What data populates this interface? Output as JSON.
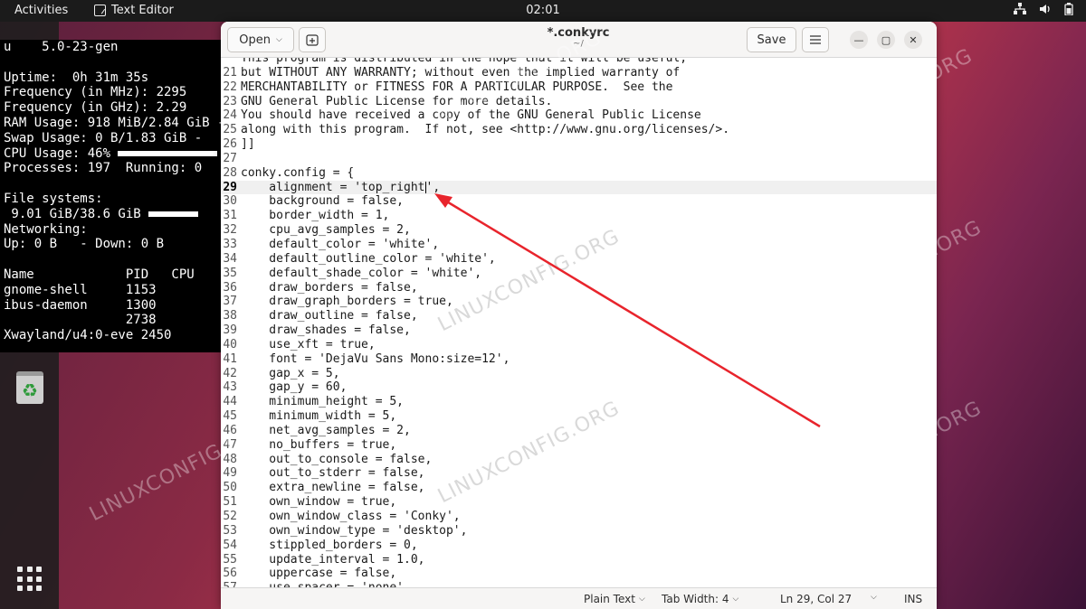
{
  "topbar": {
    "activities": "Activities",
    "app_name": "Text Editor",
    "clock": "02:01"
  },
  "conky": {
    "lines": [
      "u    5.0-23-gen",
      "",
      "Uptime:  0h 31m 35s",
      "Frequency (in MHz): 2295",
      "Frequency (in GHz): 2.29",
      "RAM Usage: 918 MiB/2.84 GiB - ",
      "Swap Usage: 0 B/1.83 GiB - ",
      "CPU Usage: 46% ",
      "Processes: 197  Running: 0",
      "",
      "File systems:",
      " 9.01 GiB/38.6 GiB ",
      "Networking:",
      "Up: 0 B   - Down: 0 B",
      "",
      "Name            PID   CPU",
      "gnome-shell     1153",
      "ibus-daemon     1300",
      "                2738",
      "Xwayland/u4:0-eve 2450"
    ],
    "cpu_fraction": 0.46,
    "fs_fraction": 0.23
  },
  "editor": {
    "open_label": "Open",
    "save_label": "Save",
    "title": "*.conkyrc",
    "subtitle": "~/",
    "current_line": 29,
    "lines": [
      {
        "n": "",
        "t": "This program is distributed in the hope that it will be useful,"
      },
      {
        "n": "21",
        "t": "but WITHOUT ANY WARRANTY; without even the implied warranty of"
      },
      {
        "n": "22",
        "t": "MERCHANTABILITY or FITNESS FOR A PARTICULAR PURPOSE.  See the"
      },
      {
        "n": "23",
        "t": "GNU General Public License for more details."
      },
      {
        "n": "24",
        "t": "You should have received a copy of the GNU General Public License"
      },
      {
        "n": "25",
        "t": "along with this program.  If not, see <http://www.gnu.org/licenses/>."
      },
      {
        "n": "26",
        "t": "]]"
      },
      {
        "n": "27",
        "t": ""
      },
      {
        "n": "28",
        "t": "conky.config = {"
      },
      {
        "n": "29",
        "t": "    alignment = 'top_right',"
      },
      {
        "n": "30",
        "t": "    background = false,"
      },
      {
        "n": "31",
        "t": "    border_width = 1,"
      },
      {
        "n": "32",
        "t": "    cpu_avg_samples = 2,"
      },
      {
        "n": "33",
        "t": "    default_color = 'white',"
      },
      {
        "n": "34",
        "t": "    default_outline_color = 'white',"
      },
      {
        "n": "35",
        "t": "    default_shade_color = 'white',"
      },
      {
        "n": "36",
        "t": "    draw_borders = false,"
      },
      {
        "n": "37",
        "t": "    draw_graph_borders = true,"
      },
      {
        "n": "38",
        "t": "    draw_outline = false,"
      },
      {
        "n": "39",
        "t": "    draw_shades = false,"
      },
      {
        "n": "40",
        "t": "    use_xft = true,"
      },
      {
        "n": "41",
        "t": "    font = 'DejaVu Sans Mono:size=12',"
      },
      {
        "n": "42",
        "t": "    gap_x = 5,"
      },
      {
        "n": "43",
        "t": "    gap_y = 60,"
      },
      {
        "n": "44",
        "t": "    minimum_height = 5,"
      },
      {
        "n": "45",
        "t": "    minimum_width = 5,"
      },
      {
        "n": "46",
        "t": "    net_avg_samples = 2,"
      },
      {
        "n": "47",
        "t": "    no_buffers = true,"
      },
      {
        "n": "48",
        "t": "    out_to_console = false,"
      },
      {
        "n": "49",
        "t": "    out_to_stderr = false,"
      },
      {
        "n": "50",
        "t": "    extra_newline = false,"
      },
      {
        "n": "51",
        "t": "    own_window = true,"
      },
      {
        "n": "52",
        "t": "    own_window_class = 'Conky',"
      },
      {
        "n": "53",
        "t": "    own_window_type = 'desktop',"
      },
      {
        "n": "54",
        "t": "    stippled_borders = 0,"
      },
      {
        "n": "55",
        "t": "    update_interval = 1.0,"
      },
      {
        "n": "56",
        "t": "    uppercase = false,"
      },
      {
        "n": "57",
        "t": "    use_spacer = 'none',"
      }
    ]
  },
  "statusbar": {
    "language": "Plain Text",
    "tab_width": "Tab Width: 4",
    "position": "Ln 29, Col 27",
    "mode": "INS"
  },
  "watermark": "LINUXCONFIG.ORG",
  "colors": {
    "accent": "#e95420",
    "arrow": "#e8242c"
  }
}
